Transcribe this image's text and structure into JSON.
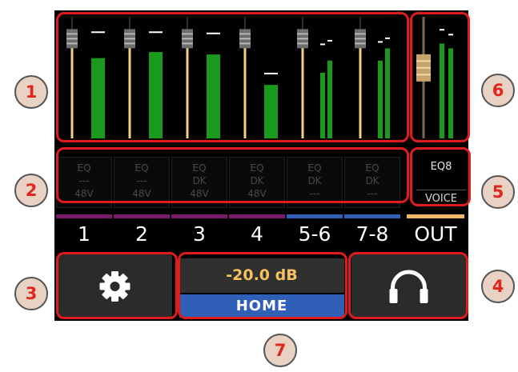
{
  "channels": [
    {
      "label": "1",
      "fader": 0.82,
      "meter_level": 0.66,
      "peak": 0.88
    },
    {
      "label": "2",
      "fader": 0.82,
      "meter_level": 0.71,
      "peak": 0.88
    },
    {
      "label": "3",
      "fader": 0.82,
      "meter_level": 0.69,
      "peak": 0.87
    },
    {
      "label": "4",
      "fader": 0.82,
      "meter_level": 0.44,
      "peak": 0.54
    },
    {
      "label": "5-6",
      "fader": 0.82,
      "meter_level": 0.54,
      "peak": 0.78,
      "stereo": true
    },
    {
      "label": "7-8",
      "fader": 0.82,
      "meter_level": 0.64,
      "peak": 0.8,
      "stereo": true
    }
  ],
  "output": {
    "label": "OUT",
    "fader": 0.58,
    "meter_level": 0.78,
    "peak": 0.9,
    "eq_label": "EQ8",
    "mode_label": "VOICE"
  },
  "channel_settings": [
    {
      "eq": "EQ",
      "dk": "---",
      "phantom": "48V"
    },
    {
      "eq": "EQ",
      "dk": "---",
      "phantom": "48V"
    },
    {
      "eq": "EQ",
      "dk": "DK",
      "phantom": "48V"
    },
    {
      "eq": "EQ",
      "dk": "DK",
      "phantom": "48V"
    },
    {
      "eq": "EQ",
      "dk": "DK",
      "phantom": "---"
    },
    {
      "eq": "EQ",
      "dk": "DK",
      "phantom": "---"
    }
  ],
  "status": {
    "level_readout": "-20.0 dB",
    "mode_label": "HOME"
  },
  "buttons": {
    "settings_icon": "gear-icon",
    "headphones_icon": "headphones-icon"
  },
  "callouts": [
    "1",
    "2",
    "3",
    "4",
    "5",
    "6",
    "7"
  ],
  "colors": {
    "meter_green": "#199a1c",
    "fader_track": "#f2d28a",
    "highlight_red": "#e01b1b",
    "home_blue": "#2f5fb6",
    "readout_amber": "#f5c060",
    "stripe_colors": [
      "#7b1a6b",
      "#7b1a6b",
      "#7b1a6b",
      "#7b1a6b",
      "#2f5fb6",
      "#2f5fb6",
      "#f0b866"
    ]
  }
}
